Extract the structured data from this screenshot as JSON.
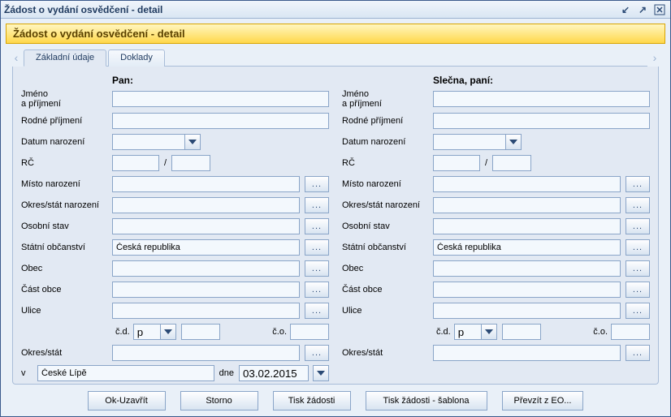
{
  "window": {
    "title": "Žádost o vydání osvědčení - detail"
  },
  "banner": {
    "title": "Žádost o vydání osvědčení - detail"
  },
  "tabs": {
    "items": [
      {
        "label": "Základní údaje"
      },
      {
        "label": "Doklady"
      }
    ]
  },
  "columns": {
    "left_header": "Pan:",
    "right_header": "Slečna, paní:"
  },
  "labels": {
    "name": "Jméno\na příjmení",
    "maiden": "Rodné příjmení",
    "dob": "Datum narození",
    "rc": "RČ",
    "birthplace": "Místo narození",
    "birthdistrict": "Okres/stát narození",
    "marital": "Osobní stav",
    "citizenship": "Státní občanství",
    "obec": "Obec",
    "castobce": "Část obce",
    "ulice": "Ulice",
    "cd": "č.d.",
    "co": "č.o.",
    "okres": "Okres/stát",
    "v": "v",
    "dne": "dne"
  },
  "values": {
    "left": {
      "name": "",
      "maiden": "",
      "dob": "",
      "rc_a": "",
      "rc_b": "",
      "birthplace": "",
      "birthdistrict": "",
      "marital": "",
      "citizenship": "Česká republika",
      "obec": "",
      "castobce": "",
      "ulice": "",
      "cd_p": "p",
      "cd_n": "",
      "co": "",
      "okres": ""
    },
    "right": {
      "name": "",
      "maiden": "",
      "dob": "",
      "rc_a": "",
      "rc_b": "",
      "birthplace": "",
      "birthdistrict": "",
      "marital": "",
      "citizenship": "Česká republika",
      "obec": "",
      "castobce": "",
      "ulice": "",
      "cd_p": "p",
      "cd_n": "",
      "co": "",
      "okres": ""
    },
    "place": "České Lípě",
    "date": "03.02.2015"
  },
  "buttons": {
    "ok": "Ok-Uzavřít",
    "storno": "Storno",
    "tisk": "Tisk žádosti",
    "tisk_sablona": "Tisk žádosti - šablona",
    "prevzit": "Převzít z EO..."
  },
  "ellipsis": "..."
}
